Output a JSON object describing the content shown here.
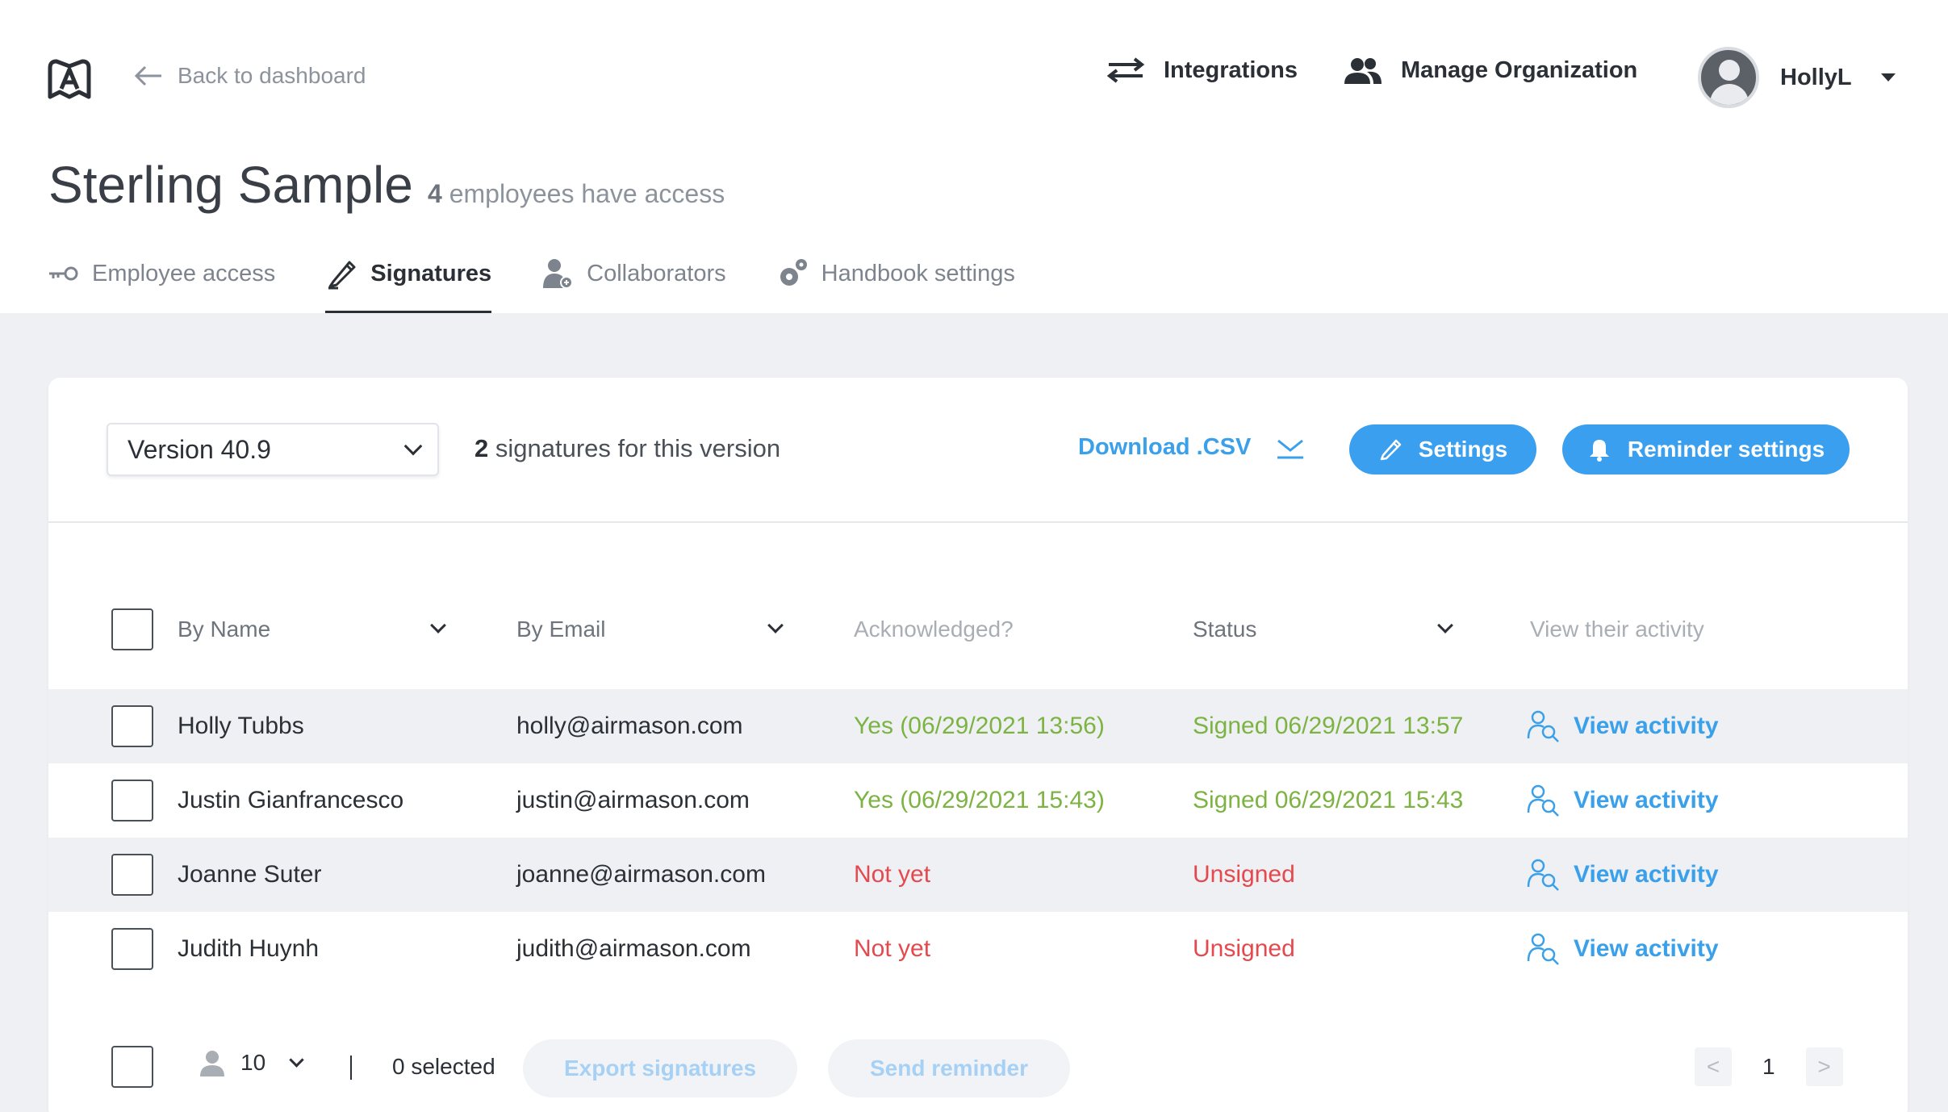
{
  "header": {
    "back_label": "Back to dashboard",
    "integrations_label": "Integrations",
    "manage_label": "Manage Organization",
    "user_name": "HollyL"
  },
  "page": {
    "title": "Sterling Sample",
    "access_count": "4",
    "access_text": "employees have access"
  },
  "tabs": [
    {
      "label": "Employee access",
      "icon": "key-icon",
      "active": false
    },
    {
      "label": "Signatures",
      "icon": "pen-icon",
      "active": true
    },
    {
      "label": "Collaborators",
      "icon": "collaborator-icon",
      "active": false
    },
    {
      "label": "Handbook settings",
      "icon": "gear-icon",
      "active": false
    }
  ],
  "toolbar": {
    "version": "Version 40.9",
    "sig_count": "2",
    "sig_text": "signatures for this version",
    "download_label": "Download .CSV",
    "settings_label": "Settings",
    "reminder_label": "Reminder settings"
  },
  "table": {
    "columns": {
      "name": "By Name",
      "email": "By Email",
      "ack": "Acknowledged?",
      "status": "Status",
      "view": "View their activity"
    },
    "rows": [
      {
        "name": "Holly Tubbs",
        "email": "holly@airmason.com",
        "ack": "Yes (06/29/2021 13:56)",
        "status": "Signed 06/29/2021 13:57",
        "view": "View activity"
      },
      {
        "name": "Justin Gianfrancesco",
        "email": "justin@airmason.com",
        "ack": "Yes (06/29/2021 15:43)",
        "status": "Signed 06/29/2021 15:43",
        "view": "View activity"
      },
      {
        "name": "Joanne Suter",
        "email": "joanne@airmason.com",
        "ack": "Not yet",
        "status": "Unsigned",
        "view": "View activity"
      },
      {
        "name": "Judith Huynh",
        "email": "judith@airmason.com",
        "ack": "Not yet",
        "status": "Unsigned",
        "view": "View activity"
      }
    ]
  },
  "footer": {
    "per_page": "10",
    "selected": "0 selected",
    "export_label": "Export signatures",
    "send_label": "Send reminder",
    "prev": "<",
    "page": "1",
    "next": ">"
  },
  "colors": {
    "accent": "#3b9fef",
    "signed": "#7cb342",
    "unsigned": "#e5484d"
  }
}
